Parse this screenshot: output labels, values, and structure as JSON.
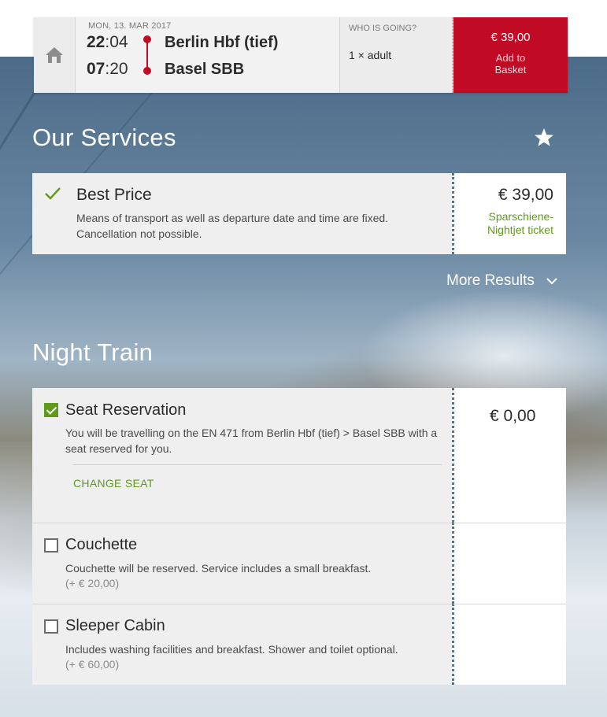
{
  "journey": {
    "date": "MON, 13. MAR 2017",
    "depart_hour": "22",
    "depart_min": ":04",
    "arrive_hour": "07",
    "arrive_min": ":20",
    "from_station": "Berlin Hbf (tief)",
    "to_station": "Basel SBB",
    "who_label": "WHO IS GOING?",
    "who_value": "1 × adult",
    "basket_price": "€ 39,00",
    "basket_label": "Add to Basket",
    "home_icon": "home-icon"
  },
  "services": {
    "title": "Our Services",
    "favorite_icon": "star-icon",
    "best_price": {
      "title": "Best Price",
      "description": "Means of transport as well as departure date and time are fixed. Cancellation not possible.",
      "price": "€ 39,00",
      "ticket_type": "Sparschiene-Nightjet ticket",
      "selected": true
    },
    "more_results": "More Results"
  },
  "night_train": {
    "title": "Night Train",
    "options": [
      {
        "title": "Seat Reservation",
        "description": "You will be travelling on the EN 471 from Berlin Hbf (tief) > Basel SBB with a seat reserved for you.",
        "action": "CHANGE SEAT",
        "price": "€  0,00",
        "checked": true
      },
      {
        "title": "Couchette",
        "description": "Couchette will be reserved. Service includes a small breakfast.",
        "extra_price": "(+ €  20,00)",
        "checked": false
      },
      {
        "title": "Sleeper Cabin",
        "description": "Includes washing facilities and breakfast. Shower and toilet optional.",
        "extra_price": "(+ €  60,00)",
        "checked": false
      }
    ]
  },
  "colors": {
    "brand_red": "#c10b25",
    "accent_green": "#5f9a1c"
  }
}
